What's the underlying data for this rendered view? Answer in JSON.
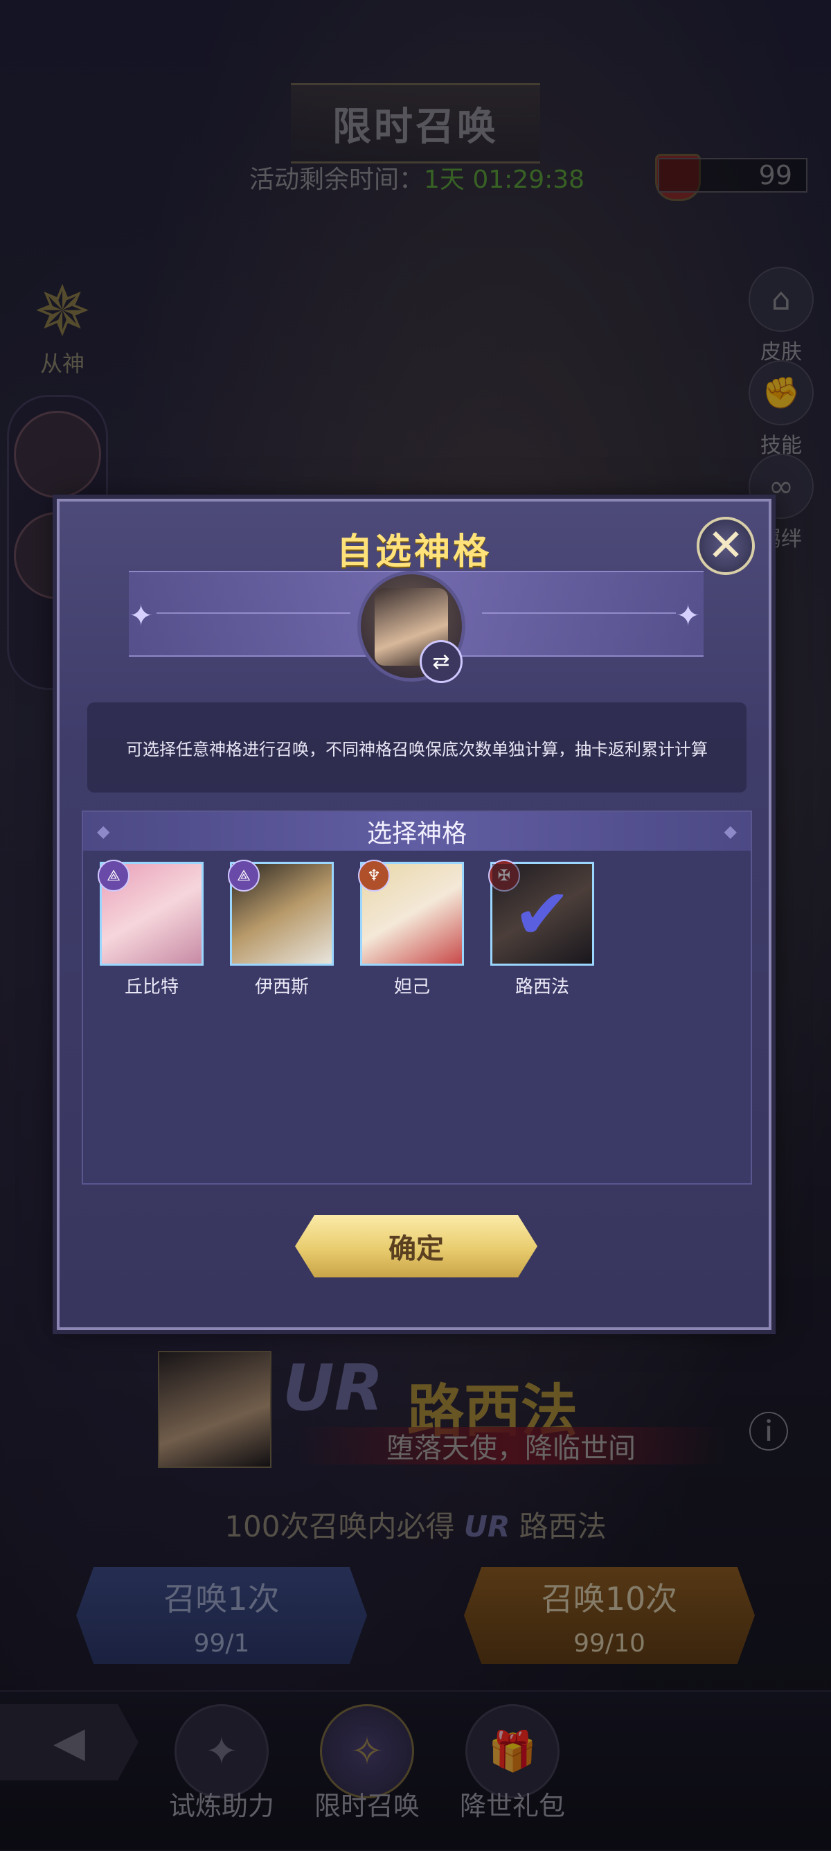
{
  "header": {
    "title": "限时召唤",
    "timer_label": "活动剩余时间：",
    "timer_value": "1天 01:29:38",
    "currency_amount": "99"
  },
  "side_buttons": [
    {
      "label": "皮肤",
      "icon": "hanger-icon"
    },
    {
      "label": "技能",
      "icon": "fist-icon"
    },
    {
      "label": "羁绊",
      "icon": "link-icon"
    }
  ],
  "left_panel": {
    "label": "从神"
  },
  "modal": {
    "title": "自选神格",
    "description": "可选择任意神格进行召唤，不同神格召唤保底次数单独计算，抽卡返利累计计算",
    "select_header": "选择神格",
    "confirm_label": "确定",
    "cards": [
      {
        "name": "丘比特",
        "selected": false,
        "badge_color": "#6a4aa8"
      },
      {
        "name": "伊西斯",
        "selected": false,
        "badge_color": "#6a4aa8"
      },
      {
        "name": "妲己",
        "selected": false,
        "badge_color": "#b0502a"
      },
      {
        "name": "路西法",
        "selected": true,
        "badge_color": "#8a2a2a"
      }
    ]
  },
  "hero": {
    "rarity": "UR",
    "name": "路西法",
    "subtitle": "堕落天使，降临世间"
  },
  "guarantee": {
    "prefix": "100次召唤内必得",
    "rarity": "UR",
    "name": "路西法"
  },
  "summon": {
    "one_label": "召唤1次",
    "one_cost": "99/1",
    "ten_label": "召唤10次",
    "ten_cost": "99/10"
  },
  "bottom_tabs": [
    {
      "label": "试炼助力"
    },
    {
      "label": "限时召唤"
    },
    {
      "label": "降世礼包"
    }
  ]
}
